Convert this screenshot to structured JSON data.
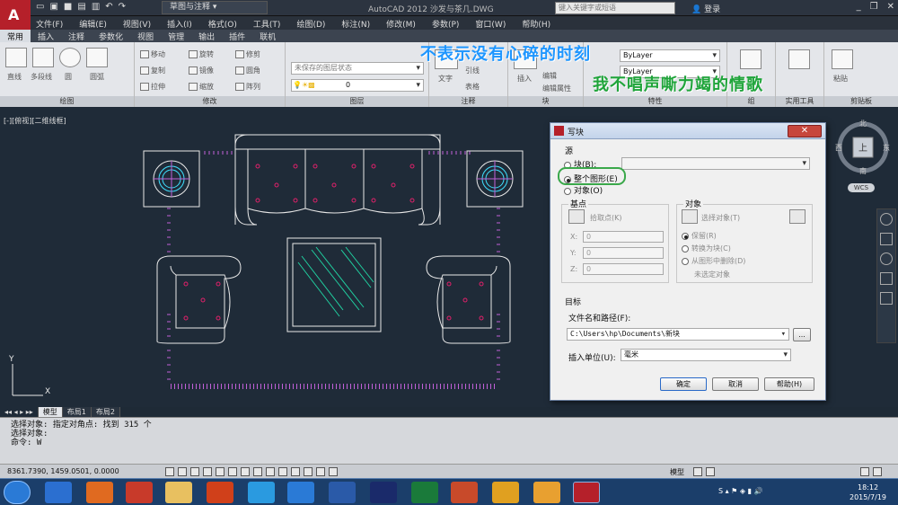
{
  "app": {
    "workspace": "草图与注释",
    "title": "AutoCAD 2012    沙发与茶几.DWG",
    "search_placeholder": "键入关键字或短语",
    "login": "登录"
  },
  "menu": [
    "文件(F)",
    "编辑(E)",
    "视图(V)",
    "插入(I)",
    "格式(O)",
    "工具(T)",
    "绘图(D)",
    "标注(N)",
    "修改(M)",
    "参数(P)",
    "窗口(W)",
    "帮助(H)"
  ],
  "ribbon_tabs": [
    "常用",
    "插入",
    "注释",
    "参数化",
    "视图",
    "管理",
    "输出",
    "插件",
    "联机"
  ],
  "ribbon": {
    "draw_items": [
      "直线",
      "多段线",
      "圆",
      "圆弧"
    ],
    "draw_title": "绘图",
    "modify_items": [
      "移动",
      "旋转",
      "修剪",
      "复制",
      "镜像",
      "圆角",
      "拉伸",
      "缩放",
      "阵列"
    ],
    "modify_title": "修改",
    "layer_state": "未保存的图层状态",
    "layer_value": "0",
    "layer_title": "图层",
    "text_label": "文字",
    "annot_items": [
      "引线",
      "表格"
    ],
    "annot_title": "注释",
    "insert_label": "插入",
    "block_items": [
      "编辑",
      "编辑属性"
    ],
    "block_title": "块",
    "props_value": "ByLayer",
    "props_title": "特性",
    "group_title": "组",
    "utility_title": "实用工具",
    "paste_label": "粘贴",
    "clipboard_title": "剪贴板"
  },
  "overlays": {
    "line1": "不表示没有心碎的时刻",
    "line2": "我不唱声嘶力竭的情歌"
  },
  "viewport": {
    "label": "[-][俯视][二维线框]",
    "cube_top": "上",
    "cube_north": "北",
    "cube_south": "南",
    "cube_east": "东",
    "cube_west": "西",
    "wcs": "WCS",
    "axis_x": "X",
    "axis_y": "Y"
  },
  "dialog": {
    "title": "写块",
    "source_label": "源",
    "opt_block": "块(B):",
    "opt_whole": "整个图形(E)",
    "opt_objects": "对象(O)",
    "base_label": "基点",
    "pick_point": "拾取点(K)",
    "x_label": "X:",
    "y_label": "Y:",
    "z_label": "Z:",
    "x_value": "0",
    "y_value": "0",
    "z_value": "0",
    "objects_label": "对象",
    "select_objects": "选择对象(T)",
    "retain": "保留(R)",
    "convert": "转换为块(C)",
    "delete": "从图形中删除(D)",
    "none_selected": "未选定对象",
    "target_label": "目标",
    "filename_label": "文件名和路径(F):",
    "filename_value": "C:\\Users\\hp\\Documents\\新块",
    "browse": "...",
    "units_label": "插入单位(U):",
    "units_value": "毫米",
    "ok": "确定",
    "cancel": "取消",
    "help": "帮助(H)"
  },
  "layout_tabs": [
    "模型",
    "布局1",
    "布局2"
  ],
  "command": {
    "line1": "选择对象: 指定对角点: 找到 315 个",
    "line2": "选择对象:",
    "line3": "命令: W"
  },
  "status": {
    "coords": "8361.7390, 1459.0501, 0.0000",
    "model": "模型"
  },
  "taskbar": {
    "time": "18:12",
    "date": "2015/7/19"
  },
  "colors": {
    "canvas": "#1f2b38",
    "furniture": "#e8e8e8",
    "rug": "#c060d8",
    "points": "#e0206a",
    "glass": "#20d0a0",
    "cyan": "#40e0ff",
    "highlight": "#3aa84a"
  }
}
